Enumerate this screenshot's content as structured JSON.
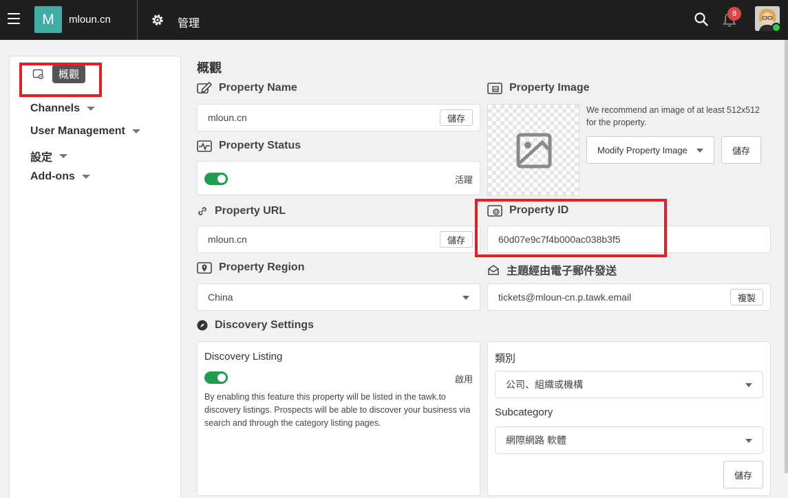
{
  "topbar": {
    "site_initial": "M",
    "site_name": "mloun.cn",
    "section_title": "管理",
    "notification_count": "8"
  },
  "sidebar": {
    "items": [
      {
        "label": "概觀",
        "active": true
      },
      {
        "label": "Channels"
      },
      {
        "label": "User Management"
      },
      {
        "label": "設定"
      },
      {
        "label": "Add-ons"
      }
    ]
  },
  "main": {
    "title": "概觀",
    "property_name": {
      "label": "Property Name",
      "value": "mloun.cn",
      "save": "儲存"
    },
    "property_status": {
      "label": "Property Status",
      "status_text": "活躍"
    },
    "property_url": {
      "label": "Property URL",
      "value": "mloun.cn",
      "save": "儲存"
    },
    "property_region": {
      "label": "Property Region",
      "value": "China"
    },
    "property_image": {
      "label": "Property Image",
      "hint": "We recommend an image of at least 512x512 for the property.",
      "modify_button": "Modify Property Image",
      "save": "儲存"
    },
    "property_id": {
      "label": "Property ID",
      "value": "60d07e9c7f4b000ac038b3f5"
    },
    "email": {
      "label": "主題經由電子郵件發送",
      "value": "tickets@mloun-cn.p.tawk.email",
      "copy": "複製"
    },
    "discovery": {
      "label": "Discovery Settings",
      "listing_title": "Discovery Listing",
      "listing_status": "啟用",
      "listing_desc": "By enabling this feature this property will be listed in the tawk.to discovery listings. Prospects will be able to discover your business via search and through the category listing pages.",
      "category_label": "類別",
      "category_value": "公司、組織或機構",
      "subcategory_label": "Subcategory",
      "subcategory_value": "網際網路 軟體",
      "save": "儲存"
    }
  },
  "colors": {
    "topbar_bg": "#1f1f1f",
    "logo_bg": "#3fada3",
    "toggle_on": "#1e9e4e",
    "highlight": "#e31e24",
    "badge": "#e04444"
  }
}
